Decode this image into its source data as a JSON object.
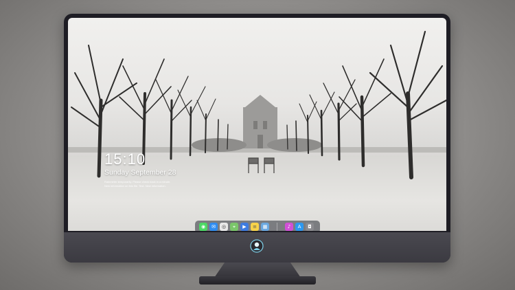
{
  "lockscreen": {
    "time": "15:10",
    "date": "Sunday September 28",
    "notice_line1": "Rainmeter temporarily. Please check back in a minute.",
    "notice_line2": "New information on this file. Test. New information."
  },
  "dock": {
    "apps": [
      {
        "icon": "messages-icon",
        "glyph": "◉",
        "color": "#4cd964"
      },
      {
        "icon": "mail-icon",
        "glyph": "✉",
        "color": "#2f8cf0"
      },
      {
        "icon": "safari-icon",
        "glyph": "◎",
        "color": "#e8e8e8"
      },
      {
        "icon": "maps-icon",
        "glyph": "⌖",
        "color": "#7bc66a"
      },
      {
        "icon": "video-icon",
        "glyph": "▶",
        "color": "#3d7be0"
      },
      {
        "icon": "notes-icon",
        "glyph": "≡",
        "color": "#f7d24a"
      },
      {
        "icon": "photos-icon",
        "glyph": "▦",
        "color": "#6aa8e0"
      },
      {
        "icon": "itunes-icon",
        "glyph": "♪",
        "color": "#d14fd6"
      },
      {
        "icon": "app-store-icon",
        "glyph": "A",
        "color": "#2c98f0"
      },
      {
        "icon": "camera-icon",
        "glyph": "◘",
        "color": "#8a8a8e"
      }
    ]
  },
  "colors": {
    "bezel": "#1e1d24",
    "chin": "#45444b",
    "text": "#ffffff"
  }
}
